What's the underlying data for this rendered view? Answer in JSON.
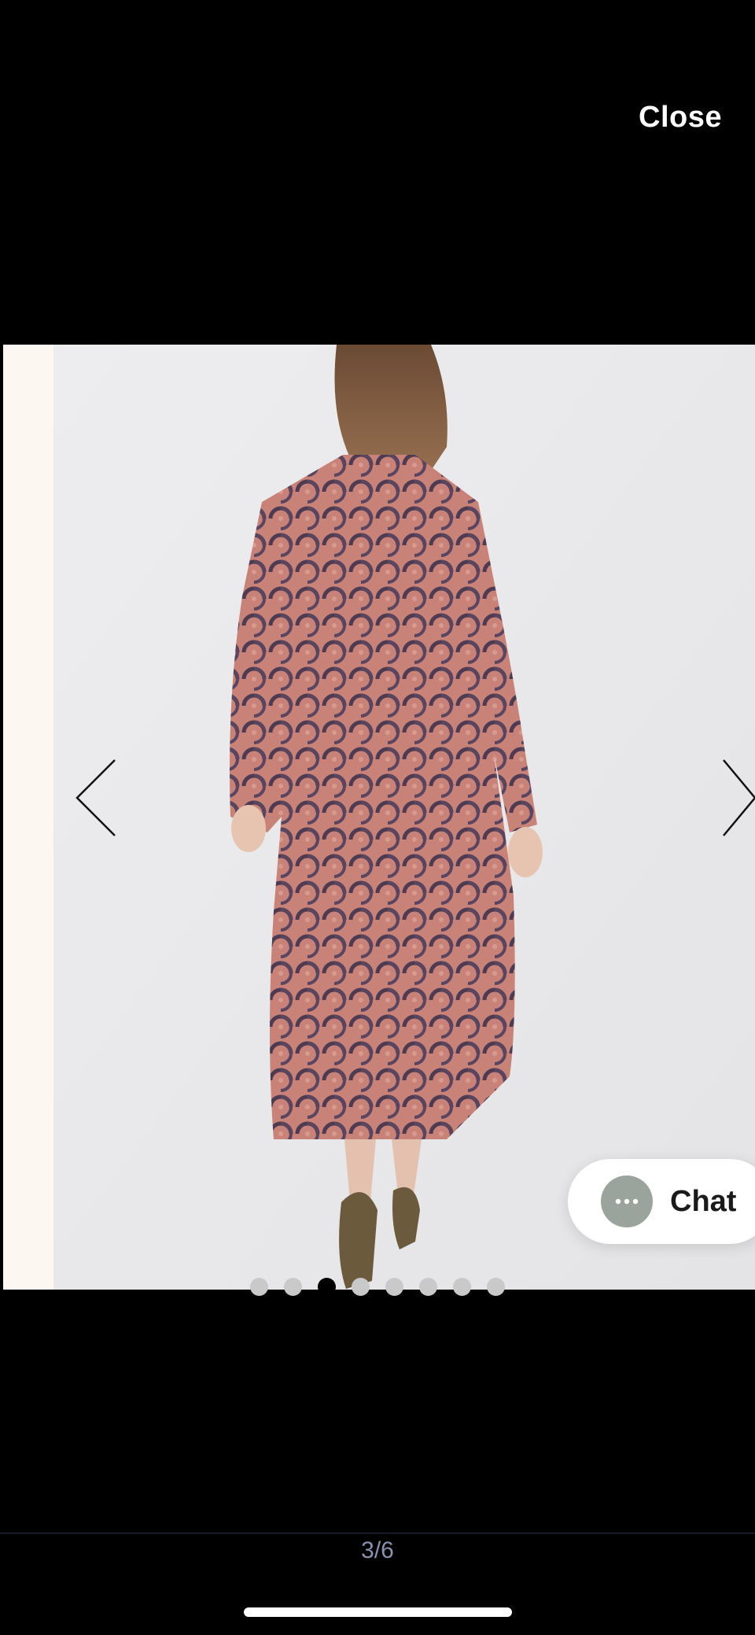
{
  "viewer": {
    "close_label": "Close",
    "counter": "3/6",
    "current_image": 3,
    "total_images": 6,
    "dots_count": 8,
    "active_dot_index": 2
  },
  "image": {
    "icon": "product-photo",
    "background_color": "#e9e9eb",
    "prev_edge_color": "#fcf7f1"
  },
  "navigation": {
    "prev_icon": "chevron-left-icon",
    "next_icon": "chevron-right-icon"
  },
  "chat": {
    "label": "Chat",
    "icon": "chat-bubble-icon",
    "icon_color": "#9aa39c"
  }
}
